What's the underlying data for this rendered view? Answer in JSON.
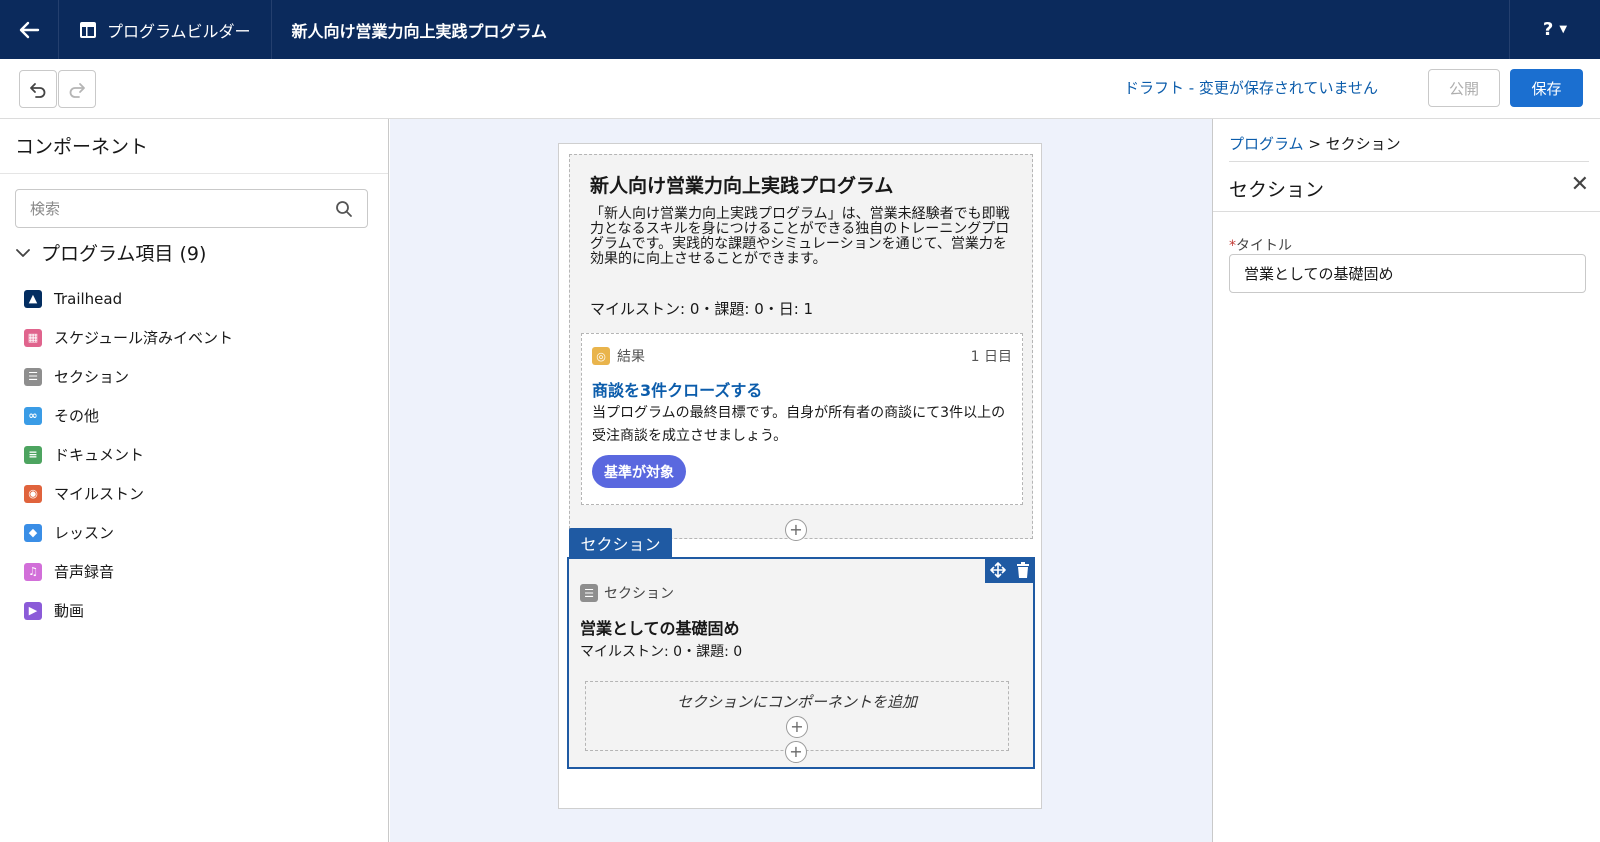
{
  "topbar": {
    "app_name": "プログラムビルダー",
    "program_title": "新人向け営業力向上実践プログラム",
    "help_label": "?"
  },
  "toolbar": {
    "status": "ドラフト - 変更が保存されていません",
    "publish_label": "公開",
    "save_label": "保存"
  },
  "left": {
    "header": "コンポーネント",
    "search_placeholder": "検索",
    "group_label": "プログラム項目 (9)",
    "items": [
      {
        "label": "Trailhead",
        "color": "#032d60"
      },
      {
        "label": "スケジュール済みイベント",
        "color": "#e0648d"
      },
      {
        "label": "セクション",
        "color": "#8e8e8e"
      },
      {
        "label": "その他",
        "color": "#3a9ce6"
      },
      {
        "label": "ドキュメント",
        "color": "#4da460"
      },
      {
        "label": "マイルストン",
        "color": "#e0633c"
      },
      {
        "label": "レッスン",
        "color": "#3a8ee6"
      },
      {
        "label": "音声録音",
        "color": "#d26fd9"
      },
      {
        "label": "動画",
        "color": "#8b5bd8"
      }
    ]
  },
  "canvas": {
    "program": {
      "title": "新人向け営業力向上実践プログラム",
      "description": "「新人向け営業力向上実践プログラム」は、営業未経験者でも即戦力となるスキルを身につけることができる独自のトレーニングプログラムです。実践的な課題やシミュレーションを通じて、営業力を効果的に向上させることができます。",
      "meta": "マイルストン: 0・課題: 0・日: 1"
    },
    "result": {
      "label": "結果",
      "day": "1 日目",
      "title": "商談を3件クローズする",
      "text": "当プログラムの最終目標です。自身が所有者の商談にて3件以上の受注商談を成立させましょう。",
      "pill": "基準が対象"
    },
    "section_tab": "セクション",
    "section": {
      "label": "セクション",
      "title": "営業としての基礎固め",
      "meta": "マイルストン: 0・課題: 0",
      "drop_text": "セクションにコンポーネントを追加"
    }
  },
  "right": {
    "breadcrumb_link": "プログラム",
    "breadcrumb_sep": " > ",
    "breadcrumb_current": "セクション",
    "header": "セクション",
    "field_required": "*",
    "field_label": "タイトル",
    "field_value": "営業としての基礎固め"
  }
}
